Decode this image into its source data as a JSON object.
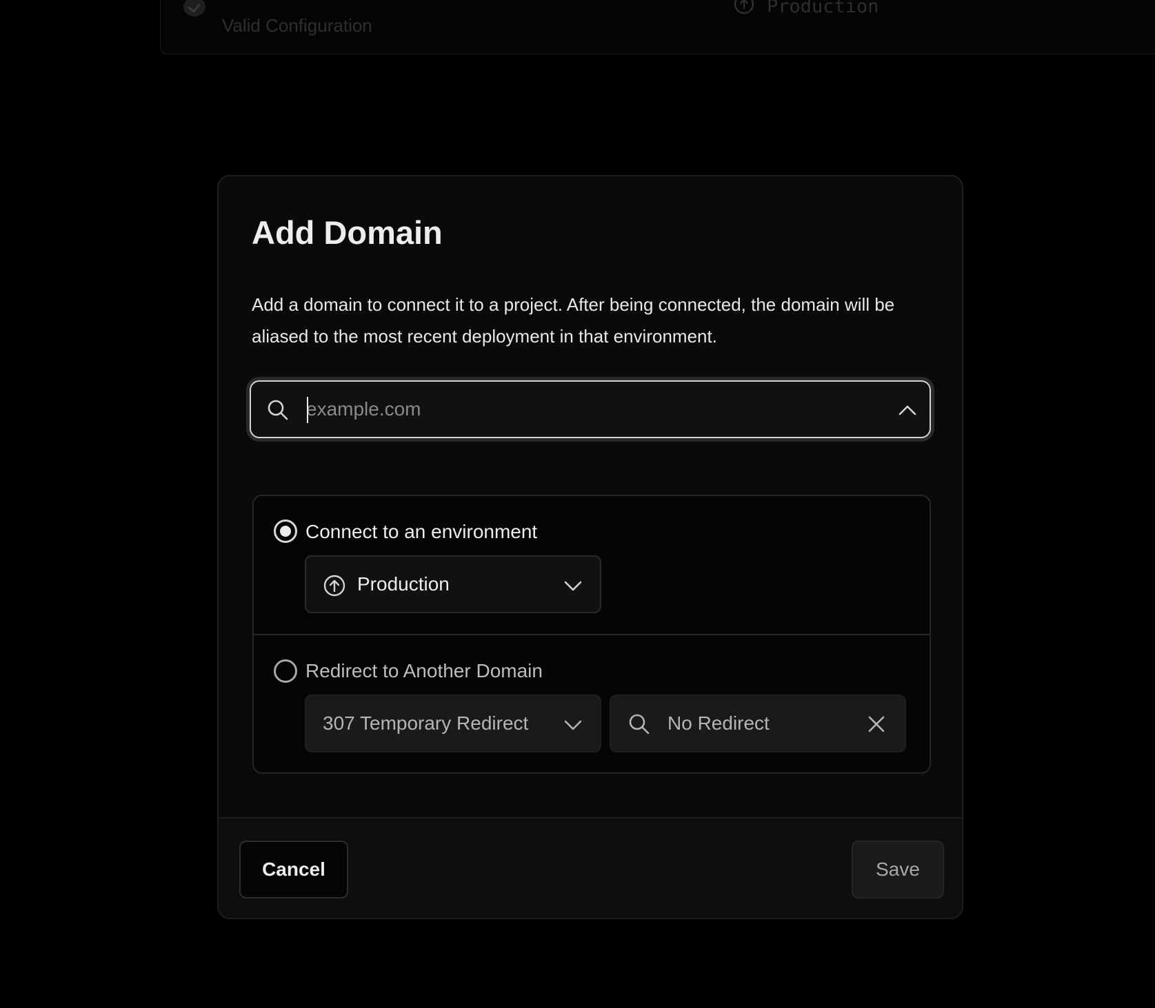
{
  "background": {
    "status_text": "Valid Configuration",
    "environment": "Production"
  },
  "modal": {
    "title": "Add Domain",
    "description": "Add a domain to connect it to a project. After being connected, the domain will be aliased to the most recent deployment in that environment.",
    "domain_input": {
      "placeholder": "example.com",
      "value": ""
    },
    "options": {
      "connect": {
        "label": "Connect to an environment",
        "selected": true,
        "environment": "Production"
      },
      "redirect": {
        "label": "Redirect to Another Domain",
        "selected": false,
        "status_code": "307 Temporary Redirect",
        "target": "No Redirect"
      }
    },
    "footer": {
      "cancel_label": "Cancel",
      "save_label": "Save"
    }
  },
  "icons": {
    "search": "search-icon",
    "chevron_up": "chevron-up-icon",
    "chevron_down": "chevron-down-icon",
    "environment": "arrow-up-circle-icon",
    "close": "close-icon",
    "check": "check-circle-icon"
  },
  "colors": {
    "background": "#000000",
    "modal": "#0a0a0a",
    "text": "#ededed",
    "muted": "#8a8a8a",
    "border": "#262626"
  }
}
